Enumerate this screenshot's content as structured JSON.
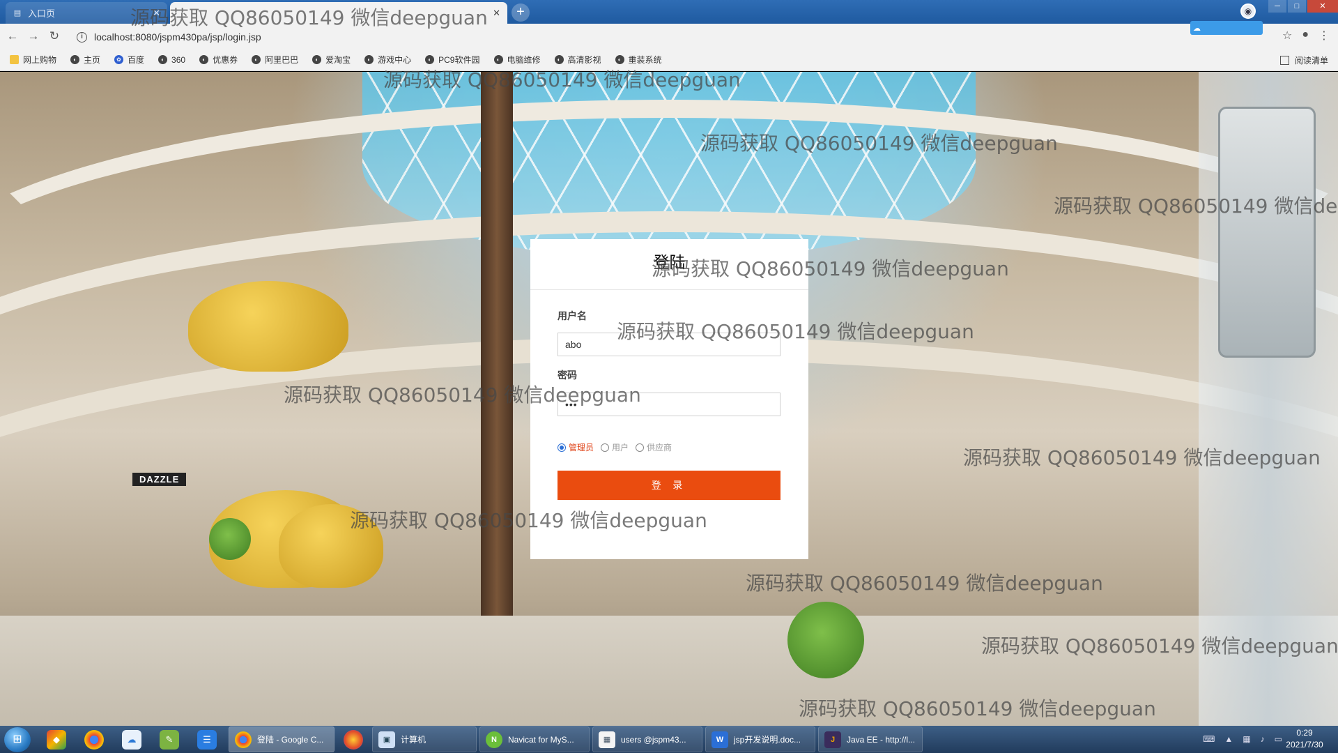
{
  "browser": {
    "tabs": [
      {
        "title": "入口页",
        "active": false
      },
      {
        "title": "",
        "active": true
      }
    ],
    "address": "localhost:8080/jspm430pa/jsp/login.jsp",
    "bookmarks": [
      {
        "label": "网上购物",
        "icon": "folder-icon"
      },
      {
        "label": "主页",
        "icon": "globe-icon"
      },
      {
        "label": "百度",
        "icon": "baidu-icon"
      },
      {
        "label": "360",
        "icon": "globe-icon"
      },
      {
        "label": "优惠券",
        "icon": "globe-icon"
      },
      {
        "label": "阿里巴巴",
        "icon": "globe-icon"
      },
      {
        "label": "爱淘宝",
        "icon": "globe-icon"
      },
      {
        "label": "游戏中心",
        "icon": "globe-icon"
      },
      {
        "label": "PC9软件园",
        "icon": "globe-icon"
      },
      {
        "label": "电脑维修",
        "icon": "globe-icon"
      },
      {
        "label": "高清影视",
        "icon": "globe-icon"
      },
      {
        "label": "重装系统",
        "icon": "globe-icon"
      }
    ],
    "reading_list": "阅读清单"
  },
  "login": {
    "title": "登陆",
    "username_label": "用户名",
    "username_value": "abo",
    "password_label": "密码",
    "password_mask": "•••",
    "roles": [
      {
        "label": "管理员",
        "checked": true
      },
      {
        "label": "用户",
        "checked": false
      },
      {
        "label": "供应商",
        "checked": false
      }
    ],
    "submit_label": "登 录",
    "accent_color": "#ea4c0f"
  },
  "background": {
    "store_sign": "DAZZLE"
  },
  "watermark_text": "源码获取 QQ86050149 微信deepguan",
  "taskbar": {
    "tasks": [
      {
        "label": "登陆 - Google C...",
        "icon": "chrome-icon",
        "active": true
      },
      {
        "label": "计算机",
        "icon": "computer-icon",
        "active": false
      },
      {
        "label": "Navicat for MyS...",
        "icon": "navicat-icon",
        "active": false
      },
      {
        "label": "users @jspm43...",
        "icon": "table-icon",
        "active": false
      },
      {
        "label": "jsp开发说明.doc...",
        "icon": "wps-icon",
        "active": false
      },
      {
        "label": "Java EE - http://l...",
        "icon": "eclipse-icon",
        "active": false
      }
    ],
    "time": "0:29",
    "date": "2021/7/30"
  }
}
